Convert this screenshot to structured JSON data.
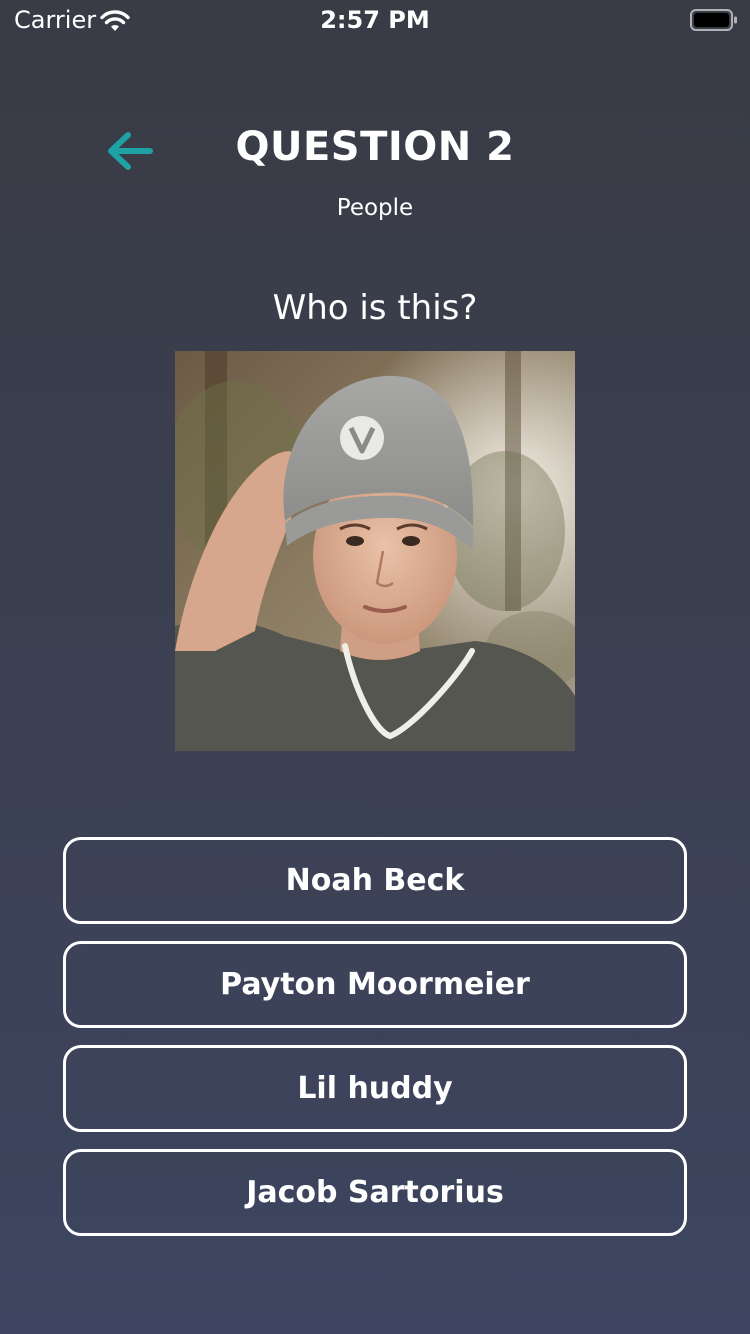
{
  "status_bar": {
    "carrier": "Carrier",
    "time": "2:57 PM",
    "wifi_icon": "wifi-icon",
    "battery_icon": "battery-full-icon"
  },
  "header": {
    "back_icon": "arrow-left-icon",
    "title": "QUESTION 2",
    "category": "People"
  },
  "question": {
    "prompt": "Who is this?",
    "image": "portrait photo of a teenage boy in a grey beanie with a V logo"
  },
  "answers": [
    {
      "label": "Noah Beck"
    },
    {
      "label": "Payton Moormeier"
    },
    {
      "label": "Lil huddy"
    },
    {
      "label": "Jacob Sartorius"
    }
  ],
  "colors": {
    "background_top": "#393c45",
    "background_bottom": "#3d4560",
    "accent": "#1fa2a5",
    "text": "#ffffff",
    "button_border": "#ffffff"
  }
}
